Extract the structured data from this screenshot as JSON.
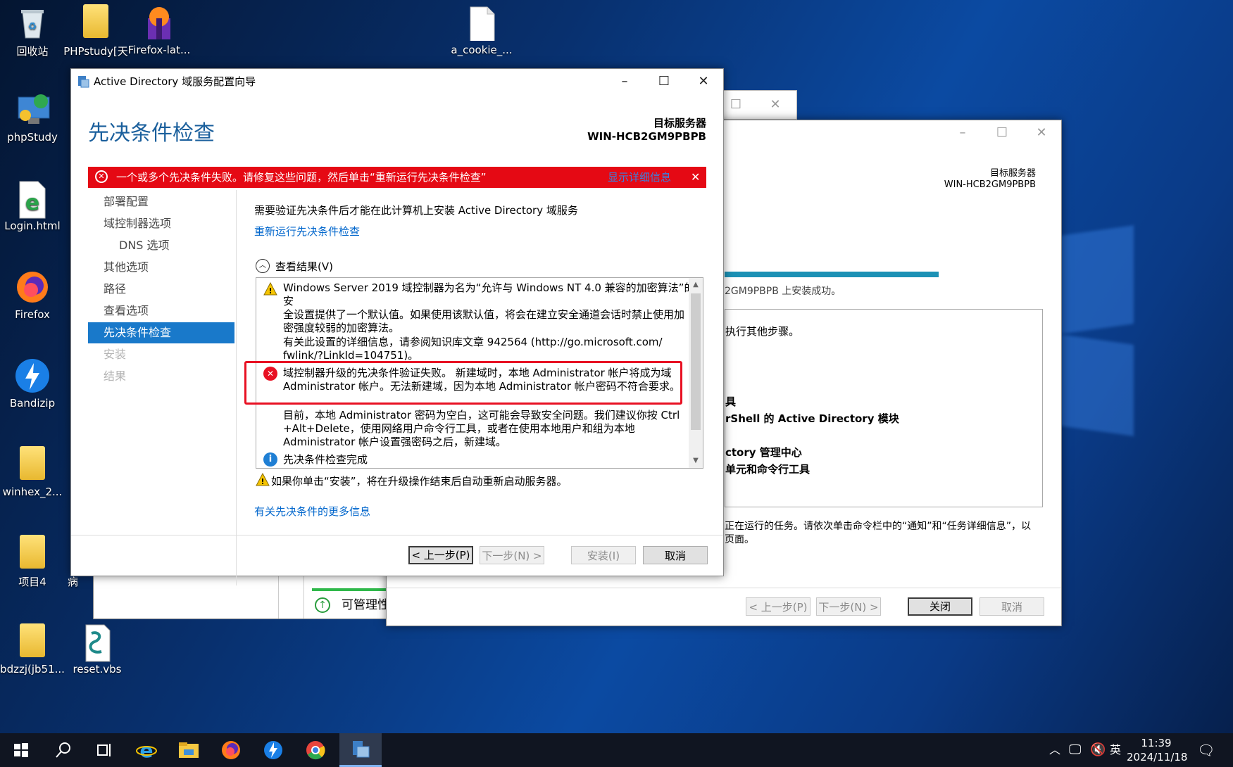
{
  "desktop": {
    "icons": [
      {
        "label": "回收站",
        "icon": "recycle-bin-icon"
      },
      {
        "label": "PHPstudy[天",
        "icon": "folder-icon"
      },
      {
        "label": "Firefox-lat...",
        "icon": "firefox-installer-icon"
      },
      {
        "label": "a_cookie_...",
        "icon": "file-icon"
      },
      {
        "label": "phpStudy",
        "icon": "phpstudy-icon"
      },
      {
        "label": "Login.html",
        "icon": "ie-html-icon"
      },
      {
        "label": "Firefox",
        "icon": "firefox-icon"
      },
      {
        "label": "Bandizip",
        "icon": "bandizip-icon"
      },
      {
        "label": "winhex_2...",
        "icon": "folder-icon"
      },
      {
        "label": "项目4",
        "icon": "folder-icon"
      },
      {
        "label": "病",
        "icon": "folder-icon"
      },
      {
        "label": "bdzzj(jb51...",
        "icon": "folder-icon"
      },
      {
        "label": "reset.vbs",
        "icon": "vbs-script-icon"
      }
    ]
  },
  "bg_window": {
    "target_label": "目标服务器",
    "target_name": "WIN-HCB2GM9PBPB",
    "success_text": "2GM9PBPB 上安装成功。",
    "step_text": "执行其他步骤。",
    "list": [
      "具",
      "rShell 的 Active Directory 模块",
      "ctory 管理中心",
      "单元和命令行工具"
    ],
    "note_line1": "正在运行的任务。请依次单击命令栏中的“通知”和“任务详细信息”，以",
    "note_line2": "页面。",
    "buttons": {
      "prev": "< 上一步(P)",
      "next": "下一步(N) >",
      "close": "关闭",
      "cancel": "取消"
    }
  },
  "behind_window": {
    "manageability": "可管理性"
  },
  "wizard": {
    "title": "Active Directory 域服务配置向导",
    "heading": "先决条件检查",
    "target_label": "目标服务器",
    "target_name": "WIN-HCB2GM9PBPB",
    "error_banner": {
      "text": "一个或多个先决条件失败。请修复这些问题，然后单击“重新运行先决条件检查”",
      "details_link": "显示详细信息"
    },
    "nav": [
      {
        "label": "部署配置",
        "state": "normal"
      },
      {
        "label": "域控制器选项",
        "state": "normal"
      },
      {
        "label": "DNS 选项",
        "state": "normal"
      },
      {
        "label": "其他选项",
        "state": "normal"
      },
      {
        "label": "路径",
        "state": "normal"
      },
      {
        "label": "查看选项",
        "state": "normal"
      },
      {
        "label": "先决条件检查",
        "state": "selected"
      },
      {
        "label": "安装",
        "state": "disabled"
      },
      {
        "label": "结果",
        "state": "disabled"
      }
    ],
    "intro": "需要验证先决条件后才能在此计算机上安装 Active Directory 域服务",
    "rerun_link": "重新运行先决条件检查",
    "results_toggle": "查看结果(V)",
    "results": {
      "warn1": [
        "Windows Server 2019 域控制器为名为“允许与 Windows NT 4.0 兼容的加密算法”的安",
        "全设置提供了一个默认值。如果使用该默认值，将会在建立安全通道会话时禁止使用加",
        "密强度较弱的加密算法。"
      ],
      "info1": [
        "有关此设置的详细信息，请参阅知识库文章 942564 (http://go.microsoft.com/",
        "fwlink/?LinkId=104751)。"
      ],
      "error1": [
        "域控制器升级的先决条件验证失败。 新建域时，本地 Administrator 帐户将成为域",
        "Administrator 帐户。无法新建域，因为本地 Administrator 帐户密码不符合要求。"
      ],
      "error_detail": [
        "目前，本地 Administrator 密码为空白，这可能会导致安全问题。我们建议你按 Ctrl",
        "+Alt+Delete，使用网络用户命令行工具，或者在使用本地用户和组为本地",
        "Administrator 帐户设置强密码之后，新建域。"
      ],
      "done": "先决条件检查完成"
    },
    "restart_warning": "如果你单击“安装”，将在升级操作结束后自动重新启动服务器。",
    "more_info_link": "有关先决条件的更多信息",
    "buttons": {
      "prev": "< 上一步(P)",
      "next": "下一步(N) >",
      "install": "安装(I)",
      "cancel": "取消"
    }
  },
  "taskbar": {
    "time": "11:39",
    "date": "2024/11/18",
    "ime": "英"
  },
  "colors": {
    "accent": "#1979ca",
    "error_banner": "#e50914",
    "heading": "#1a5f9c",
    "link": "#0066cc",
    "highlight_box": "#e81123"
  }
}
